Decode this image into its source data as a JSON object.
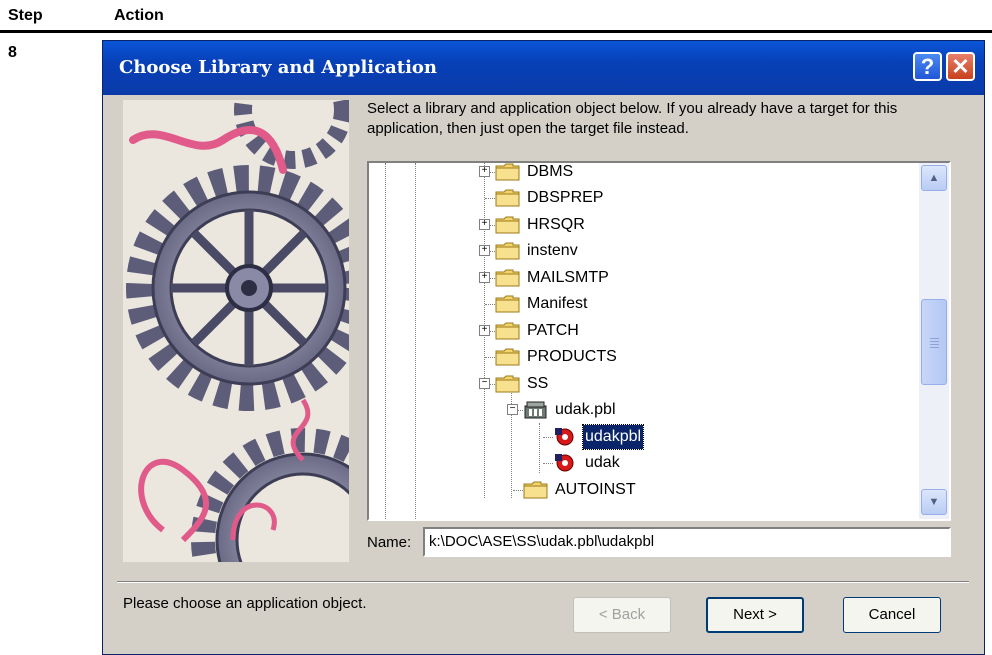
{
  "table": {
    "col_step": "Step",
    "col_action": "Action",
    "step_number": "8"
  },
  "dialog": {
    "title": "Choose Library and Application",
    "help_glyph": "?",
    "close_glyph": "✕",
    "instruction": "Select a library and application object below.  If you already have a target for this application, then just open the target file instead.",
    "tree_items": [
      {
        "label": "DBMS",
        "icon": "folder-icon",
        "expander": "+"
      },
      {
        "label": "DBSPREP",
        "icon": "folder-icon",
        "expander": ""
      },
      {
        "label": "HRSQR",
        "icon": "folder-icon",
        "expander": "+"
      },
      {
        "label": "instenv",
        "icon": "folder-icon",
        "expander": "+"
      },
      {
        "label": "MAILSMTP",
        "icon": "folder-icon",
        "expander": "+"
      },
      {
        "label": "Manifest",
        "icon": "folder-icon",
        "expander": ""
      },
      {
        "label": "PATCH",
        "icon": "folder-icon",
        "expander": "+"
      },
      {
        "label": "PRODUCTS",
        "icon": "folder-icon",
        "expander": ""
      },
      {
        "label": "SS",
        "icon": "folder-icon",
        "expander": "−"
      },
      {
        "label": "udak.pbl",
        "icon": "library-icon",
        "expander": "−"
      },
      {
        "label": "udakpbl",
        "icon": "application-object-icon",
        "expander": "",
        "selected": true
      },
      {
        "label": "udak",
        "icon": "application-object-icon",
        "expander": ""
      },
      {
        "label": "AUTOINST",
        "icon": "folder-icon",
        "expander": ""
      }
    ],
    "name_label": "Name:",
    "name_value": "k:\\DOC\\ASE\\SS\\udak.pbl\\udakpbl",
    "status": "Please choose an application object.",
    "back_label": "< Back",
    "next_label": "Next >",
    "cancel_label": "Cancel"
  }
}
